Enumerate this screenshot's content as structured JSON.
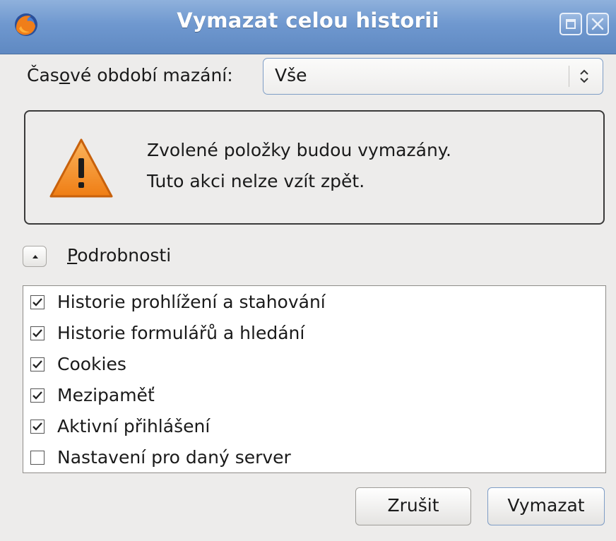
{
  "window": {
    "title": "Vymazat celou historii",
    "icons": [
      "firefox-icon",
      "maximize-icon",
      "close-icon"
    ]
  },
  "time_range": {
    "label_prefix": "Čas",
    "label_mnemonic": "o",
    "label_suffix": "vé období mazání:",
    "selected": "Vše"
  },
  "warning": {
    "icon": "warning-icon",
    "line1": "Zvolené položky budou vymazány.",
    "line2": "Tuto akci nelze vzít zpět."
  },
  "details": {
    "mnemonic": "P",
    "label_rest": "odrobnosti",
    "expanded": true
  },
  "items": [
    {
      "label": "Historie prohlížení a stahování",
      "checked": true
    },
    {
      "label": "Historie formulářů a hledání",
      "checked": true
    },
    {
      "label": "Cookies",
      "checked": true
    },
    {
      "label": "Mezipaměť",
      "checked": true
    },
    {
      "label": "Aktivní přihlášení",
      "checked": true
    },
    {
      "label": "Nastavení pro daný server",
      "checked": false
    }
  ],
  "buttons": {
    "cancel": "Zrušit",
    "clear": "Vymazat"
  },
  "colors": {
    "titlebar": "#6f98cf",
    "window_bg": "#edeceb",
    "warning_orange": "#f08a24"
  }
}
